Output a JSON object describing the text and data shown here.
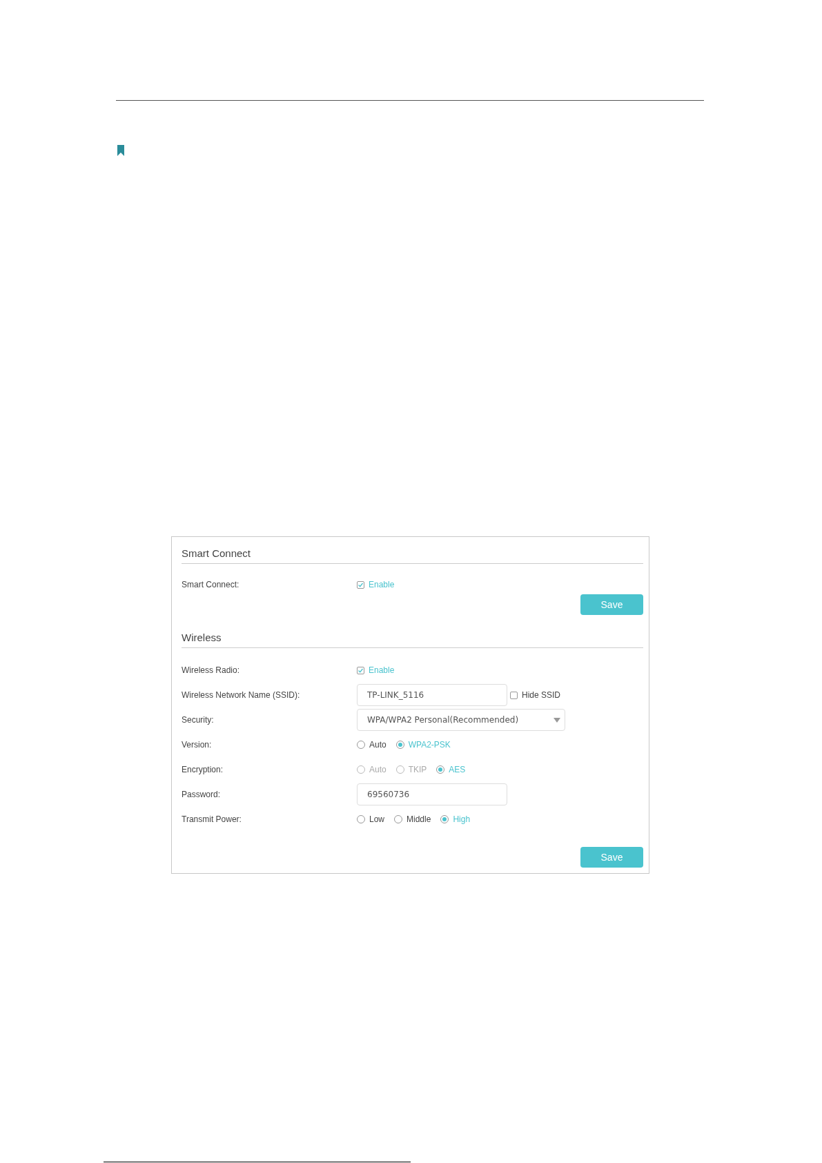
{
  "sections": [
    {
      "title": "Smart Connect",
      "rows": [
        {
          "kind": "checkbox",
          "label": "Smart Connect:",
          "option": "Enable",
          "checked": true
        }
      ],
      "save": "Save"
    },
    {
      "title": "Wireless",
      "rows": [
        {
          "kind": "checkbox",
          "label": "Wireless Radio:",
          "option": "Enable",
          "checked": true
        },
        {
          "kind": "text",
          "label": "Wireless Network Name (SSID):",
          "value": "TP-LINK_5116",
          "extra": {
            "label": "Hide SSID",
            "checked": false
          }
        },
        {
          "kind": "select",
          "label": "Security:",
          "value": "WPA/WPA2 Personal(Recommended)"
        },
        {
          "kind": "radio",
          "label": "Version:",
          "options": [
            {
              "label": "Auto",
              "selected": false,
              "disabled": false
            },
            {
              "label": "WPA2-PSK",
              "selected": true,
              "disabled": false
            }
          ]
        },
        {
          "kind": "radio",
          "label": "Encryption:",
          "options": [
            {
              "label": "Auto",
              "selected": false,
              "disabled": true
            },
            {
              "label": "TKIP",
              "selected": false,
              "disabled": true
            },
            {
              "label": "AES",
              "selected": true,
              "disabled": false
            }
          ]
        },
        {
          "kind": "text",
          "label": "Password:",
          "value": "69560736"
        },
        {
          "kind": "radio",
          "label": "Transmit Power:",
          "options": [
            {
              "label": "Low",
              "selected": false,
              "disabled": false
            },
            {
              "label": "Middle",
              "selected": false,
              "disabled": false
            },
            {
              "label": "High",
              "selected": true,
              "disabled": false
            }
          ]
        }
      ],
      "save": "Save"
    }
  ]
}
